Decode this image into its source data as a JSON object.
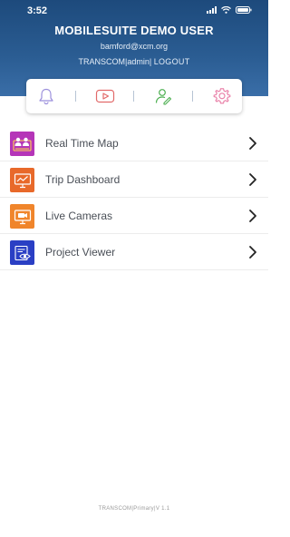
{
  "status_bar": {
    "time": "3:52"
  },
  "user": {
    "name": "MOBILESUITE DEMO USER",
    "email": "bamford@xcm.org",
    "org": "TRANSCOM",
    "role": "admin",
    "logout_label": "LOGOUT",
    "separator": "|"
  },
  "toolbar": {
    "items": [
      {
        "icon": "bell-icon",
        "color": "#9b8fdc"
      },
      {
        "icon": "video-play-icon",
        "color": "#e26a6a"
      },
      {
        "icon": "user-edit-icon",
        "color": "#4caf50"
      },
      {
        "icon": "gear-icon",
        "color": "#e87aa4"
      }
    ]
  },
  "menu": {
    "items": [
      {
        "label": "Real Time Map",
        "icon": "map-people-icon",
        "color": "#b535b8"
      },
      {
        "label": "Trip Dashboard",
        "icon": "monitor-chart-icon",
        "color": "#e8692a"
      },
      {
        "label": "Live Cameras",
        "icon": "camera-monitor-icon",
        "color": "#f0852b"
      },
      {
        "label": "Project Viewer",
        "icon": "eye-document-icon",
        "color": "#2a3fc4"
      }
    ]
  },
  "footer": {
    "text": "TRANSCOM|Primary|V 1.1"
  }
}
